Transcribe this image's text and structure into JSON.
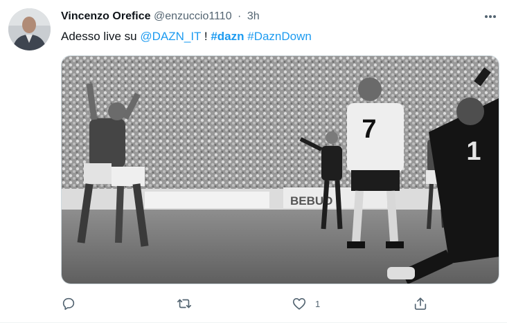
{
  "tweet": {
    "display_name": "Vincenzo Orefice",
    "handle": "@enzuccio1110",
    "separator": "·",
    "timestamp": "3h",
    "text_prefix": "Adesso live su ",
    "mention": "@DAZN_IT",
    "text_mid": " ! ",
    "hashtag_1": "#dazn",
    "hashtag_2": "#DaznDown"
  },
  "media": {
    "jersey_number_main": "7",
    "jersey_number_keeper": "1",
    "billboard_text": "BEBUO"
  },
  "actions": {
    "reply_icon": "reply-icon",
    "retweet_icon": "retweet-icon",
    "like_icon": "heart-icon",
    "like_count": "1",
    "share_icon": "share-icon"
  },
  "colors": {
    "link": "#1d9bf0",
    "secondary_text": "#536471",
    "primary_text": "#0f1419"
  }
}
